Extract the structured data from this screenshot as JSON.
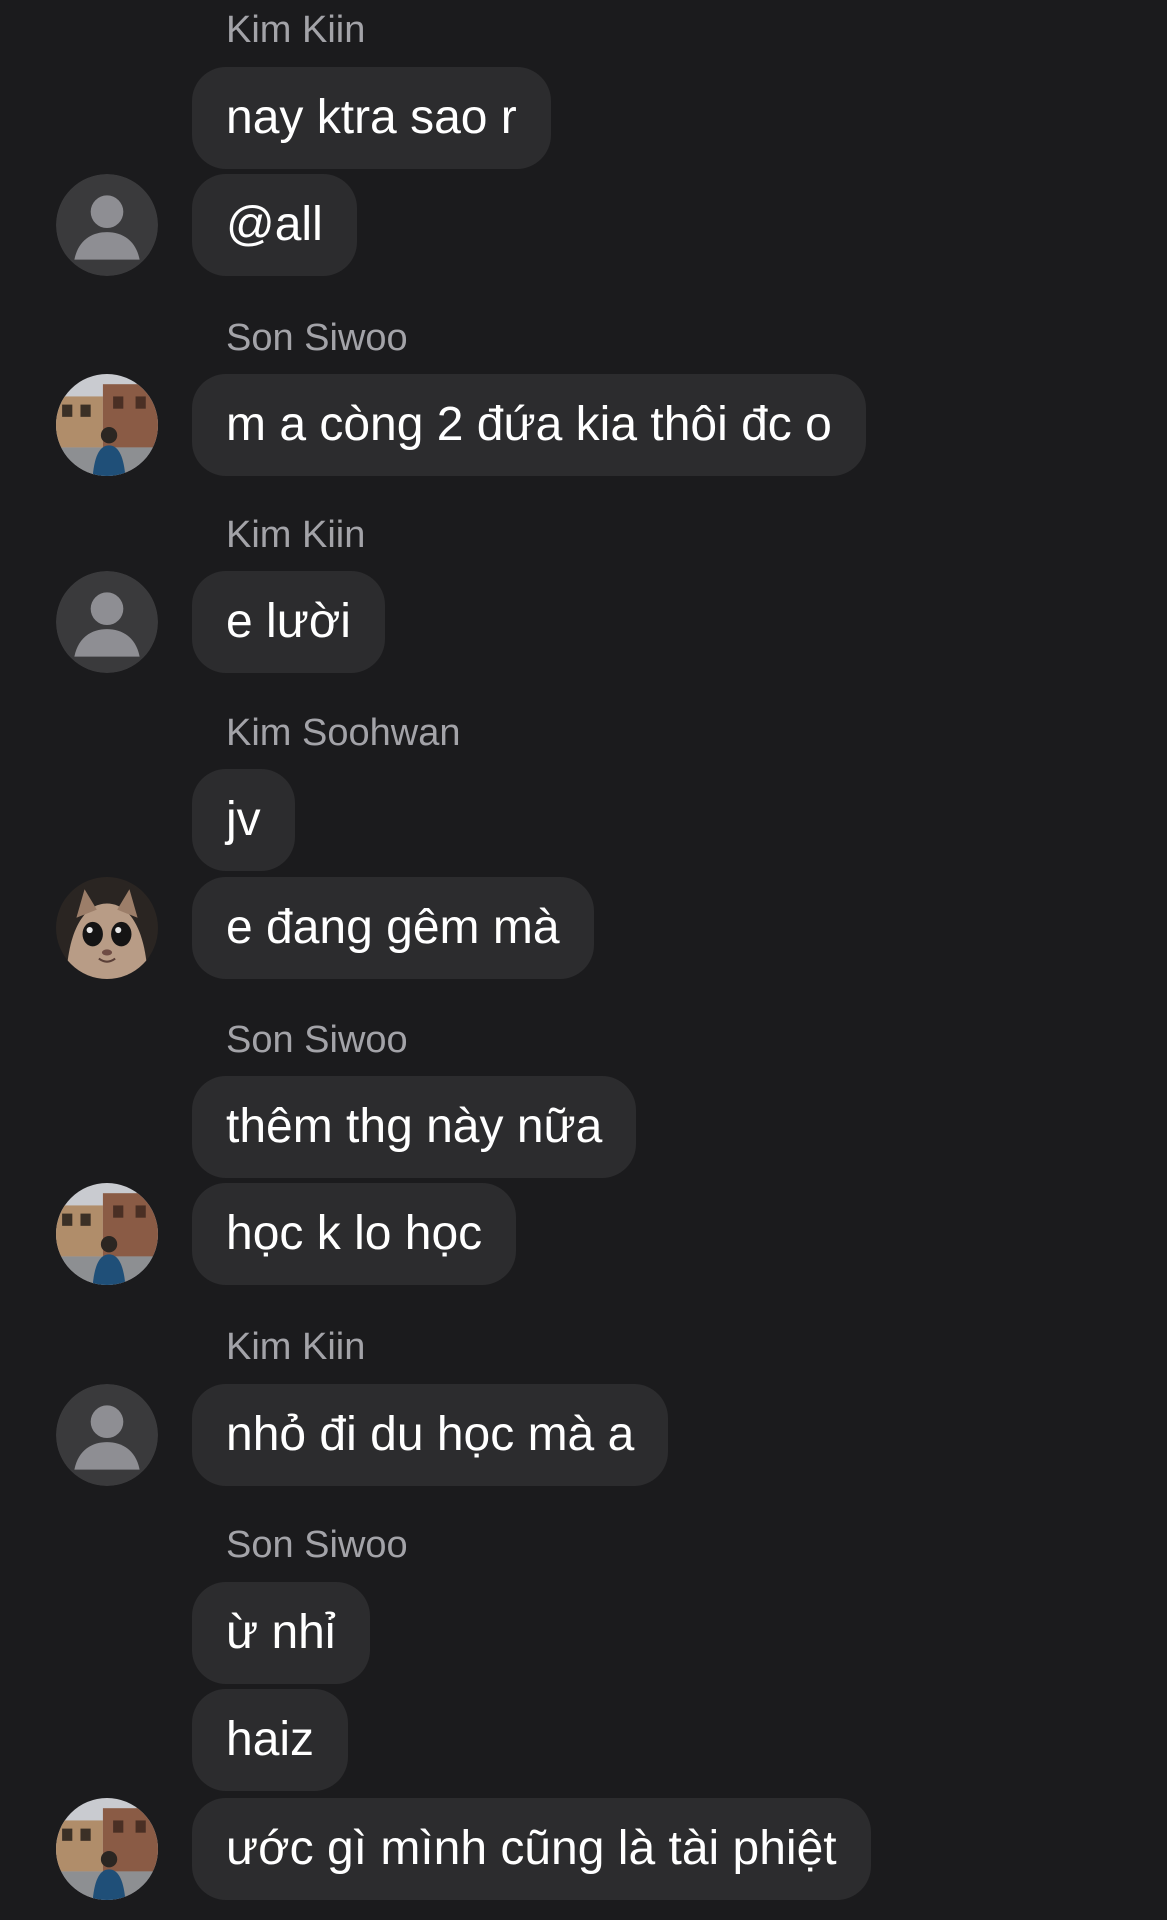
{
  "colors": {
    "background": "#1b1b1d",
    "bubble": "#2c2c2e",
    "text": "#ffffff",
    "sender": "#a3a3a8"
  },
  "messages": [
    {
      "sender": "Kim Kiin",
      "lines": [
        "nay ktra sao r",
        "@all"
      ],
      "avatar": "default-person-icon"
    },
    {
      "sender": "Son Siwoo",
      "lines": [
        "m a còng 2 đứa kia thôi đc o"
      ],
      "avatar": "street-photo-avatar"
    },
    {
      "sender": "Kim Kiin",
      "lines": [
        "e lười"
      ],
      "avatar": "default-person-icon"
    },
    {
      "sender": "Kim Soohwan",
      "lines": [
        "jv",
        "e đang gêm mà"
      ],
      "avatar": "cat-avatar"
    },
    {
      "sender": "Son Siwoo",
      "lines": [
        "thêm thg này nữa",
        "học k lo học"
      ],
      "avatar": "street-photo-avatar"
    },
    {
      "sender": "Kim Kiin",
      "lines": [
        "nhỏ đi du học mà a"
      ],
      "avatar": "default-person-icon"
    },
    {
      "sender": "Son Siwoo",
      "lines": [
        "ừ nhỉ",
        "haiz",
        "ước gì mình cũng là tài phiệt"
      ],
      "avatar": "street-photo-avatar"
    }
  ]
}
